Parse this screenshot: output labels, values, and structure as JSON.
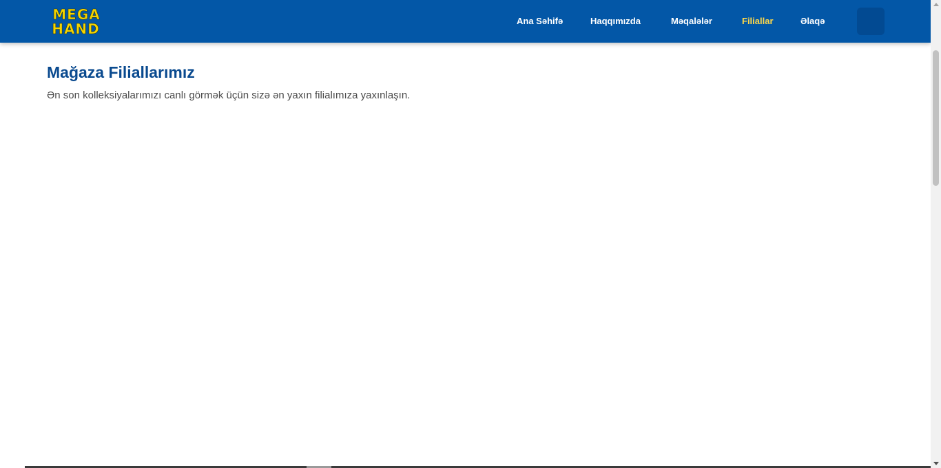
{
  "brand": {
    "logo_line1": "MEGA",
    "logo_line2": "HAND",
    "logo_color": "#f5d400",
    "nav_bg": "#0357a7"
  },
  "nav": {
    "items": [
      {
        "label": "Ana Səhifə",
        "active": false
      },
      {
        "label": "Haqqımızda",
        "active": false
      },
      {
        "label": "Məqalələr",
        "active": false
      },
      {
        "label": "Filiallar",
        "active": true
      },
      {
        "label": "Əlaqə",
        "active": false
      }
    ],
    "active_color": "#ffd84a"
  },
  "main": {
    "title": "Mağaza Filiallarımız",
    "subtitle": "Ən son kolleksiyalarımızı canlı görmək üçün sizə ən yaxın filialımıza yaxınlaşın.",
    "title_color": "#0a4a8f"
  }
}
